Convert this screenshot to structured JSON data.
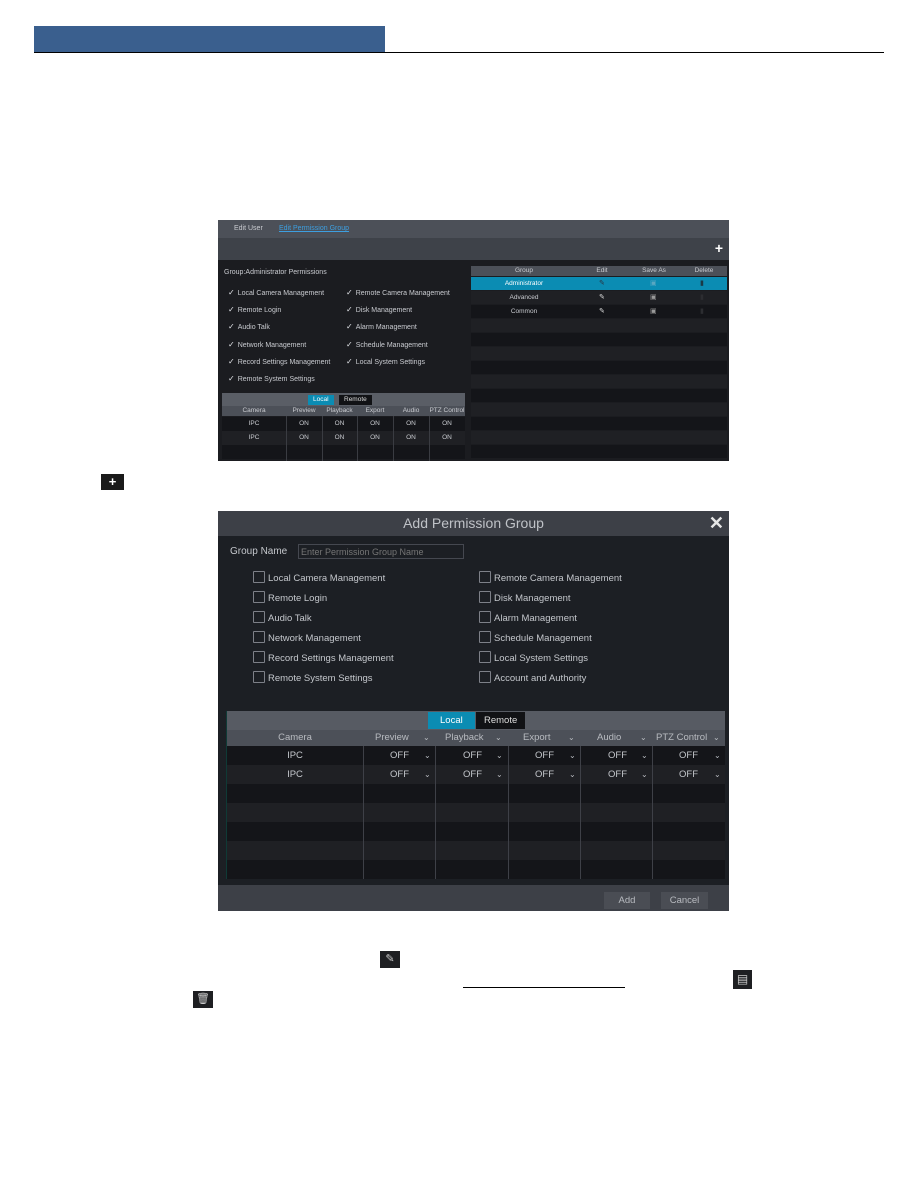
{
  "page": {
    "header_bar_color": "#3a5f8e"
  },
  "screenshot1": {
    "tabs": [
      {
        "label": "Edit User",
        "active": false
      },
      {
        "label": "Edit Permission Group",
        "active": true
      }
    ],
    "add_icon": "plus-icon",
    "group_title": "Group:Administrator Permissions",
    "permissions_left": [
      "Local Camera Management",
      "Remote Login",
      "Audio Talk",
      "Network Management",
      "Record Settings Management",
      "Remote System Settings"
    ],
    "permissions_right": [
      "Remote Camera Management",
      "Disk Management",
      "Alarm Management",
      "Schedule Management",
      "Local System Settings"
    ],
    "check_glyph": "✓",
    "segment": {
      "local": "Local",
      "remote": "Remote",
      "active": "Local"
    },
    "camera_table": {
      "columns": [
        "Camera",
        "Preview",
        "Playback",
        "Export",
        "Audio",
        "PTZ Control"
      ],
      "rows": [
        [
          "IPC",
          "ON",
          "ON",
          "ON",
          "ON",
          "ON"
        ],
        [
          "IPC",
          "ON",
          "ON",
          "ON",
          "ON",
          "ON"
        ]
      ]
    },
    "group_table": {
      "columns": [
        "Group",
        "Edit",
        "Save As",
        "Delete"
      ],
      "rows": [
        {
          "group": "Administrator",
          "selected": true
        },
        {
          "group": "Advanced",
          "selected": false
        },
        {
          "group": "Common",
          "selected": false
        }
      ]
    },
    "accent_color": "#0b8cb3"
  },
  "inline_plus_icon": "plus-icon",
  "dialog": {
    "title": "Add Permission Group",
    "close_icon": "close-icon",
    "group_name_label": "Group Name",
    "group_name_value": "",
    "group_name_placeholder": "Enter Permission Group Name",
    "permissions_left": [
      {
        "label": "Local Camera Management",
        "checked": false
      },
      {
        "label": "Remote Login",
        "checked": false
      },
      {
        "label": "Audio Talk",
        "checked": false
      },
      {
        "label": "Network Management",
        "checked": false
      },
      {
        "label": "Record Settings Management",
        "checked": false
      },
      {
        "label": "Remote System Settings",
        "checked": false
      }
    ],
    "permissions_right": [
      {
        "label": "Remote Camera Management",
        "checked": false
      },
      {
        "label": "Disk Management",
        "checked": false
      },
      {
        "label": "Alarm Management",
        "checked": false
      },
      {
        "label": "Schedule Management",
        "checked": false
      },
      {
        "label": "Local System Settings",
        "checked": false
      },
      {
        "label": "Account and Authority",
        "checked": false
      }
    ],
    "segment": {
      "local": "Local",
      "remote": "Remote",
      "active": "Local"
    },
    "camera_table": {
      "columns": [
        "Camera",
        "Preview",
        "Playback",
        "Export",
        "Audio",
        "PTZ Control"
      ],
      "rows": [
        [
          "IPC",
          "OFF",
          "OFF",
          "OFF",
          "OFF",
          "OFF"
        ],
        [
          "IPC",
          "OFF",
          "OFF",
          "OFF",
          "OFF",
          "OFF"
        ]
      ]
    },
    "add_button": "Add",
    "cancel_button": "Cancel"
  },
  "inline_icons": [
    "edit-icon",
    "save-as-icon",
    "delete-icon"
  ]
}
